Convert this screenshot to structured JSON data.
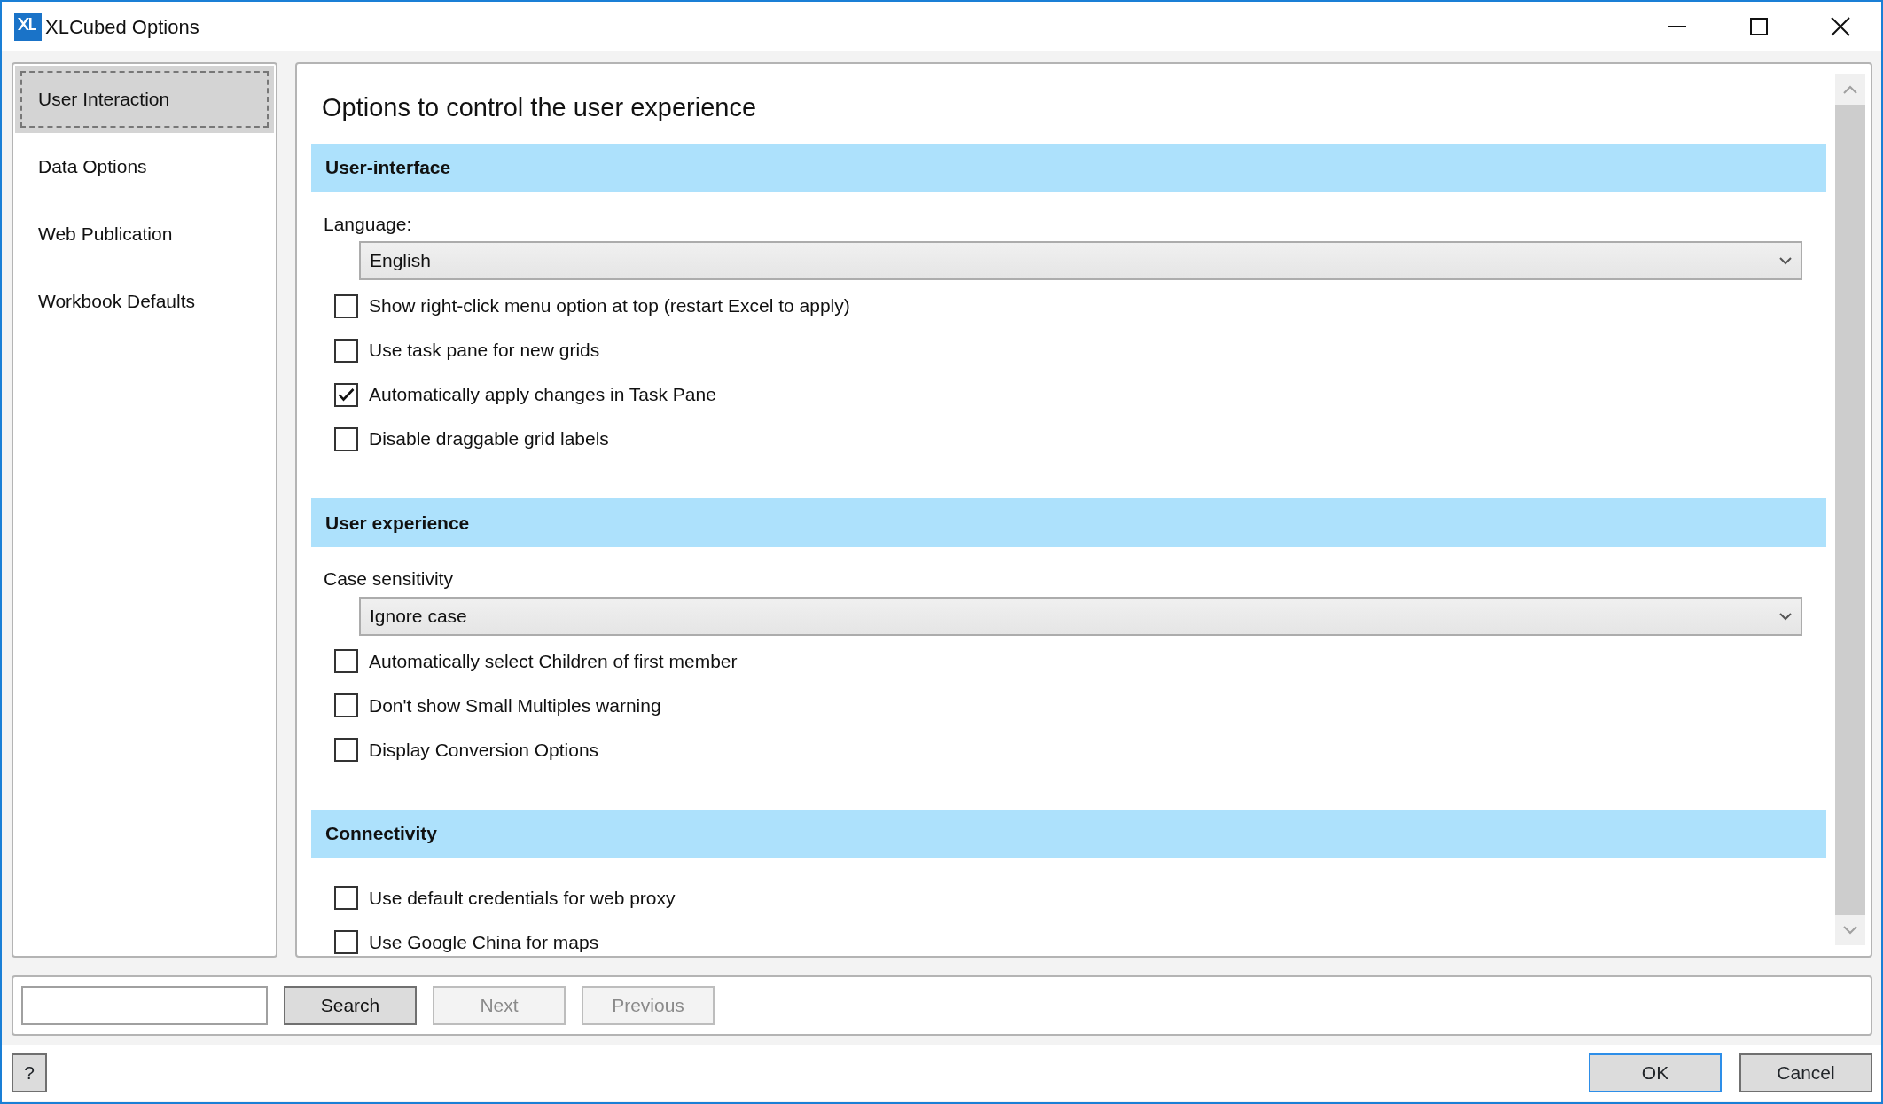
{
  "window": {
    "title": "XLCubed Options"
  },
  "sidebar": {
    "items": [
      {
        "label": "User Interaction",
        "selected": true
      },
      {
        "label": "Data Options",
        "selected": false
      },
      {
        "label": "Web Publication",
        "selected": false
      },
      {
        "label": "Workbook Defaults",
        "selected": false
      }
    ]
  },
  "content": {
    "heading": "Options to control the user experience",
    "sections": [
      {
        "title": "User-interface",
        "items": [
          {
            "kind": "dropdown",
            "label": "Language:",
            "value": "English"
          },
          {
            "kind": "checkbox",
            "label": "Show right-click menu option at top (restart Excel to apply)",
            "checked": false
          },
          {
            "kind": "checkbox",
            "label": "Use task pane for new grids",
            "checked": false
          },
          {
            "kind": "checkbox",
            "label": "Automatically apply changes in Task Pane",
            "checked": true
          },
          {
            "kind": "checkbox",
            "label": "Disable draggable grid labels",
            "checked": false
          }
        ]
      },
      {
        "title": "User experience",
        "items": [
          {
            "kind": "dropdown",
            "label": "Case sensitivity",
            "value": "Ignore case"
          },
          {
            "kind": "checkbox",
            "label": "Automatically select Children of first member",
            "checked": false
          },
          {
            "kind": "checkbox",
            "label": "Don't show Small Multiples warning",
            "checked": false
          },
          {
            "kind": "checkbox",
            "label": "Display Conversion Options",
            "checked": false
          }
        ]
      },
      {
        "title": "Connectivity",
        "items": [
          {
            "kind": "checkbox",
            "label": "Use default credentials for web proxy",
            "checked": false
          },
          {
            "kind": "checkbox",
            "label": "Use Google China for maps",
            "checked": false
          }
        ]
      }
    ]
  },
  "search_bar": {
    "buttons": [
      {
        "label": "Search",
        "disabled": false
      },
      {
        "label": "Next",
        "disabled": true
      },
      {
        "label": "Previous",
        "disabled": true
      }
    ]
  },
  "footer": {
    "help": "?",
    "buttons": [
      {
        "label": "OK",
        "focused": true
      },
      {
        "label": "Cancel",
        "focused": false
      }
    ]
  }
}
